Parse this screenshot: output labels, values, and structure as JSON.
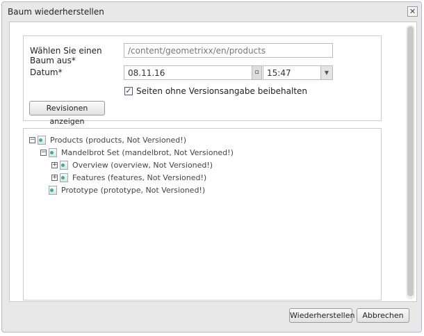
{
  "dialog": {
    "title": "Baum wiederherstellen",
    "close_icon": "close-icon"
  },
  "form": {
    "tree_label": "Wählen Sie einen Baum aus*",
    "tree_path": "/content/geometrixx/en/products",
    "date_label": "Datum*",
    "date": "08.11.16",
    "time": "15:47",
    "keep_checkbox_label": "Seiten ohne Versionsangabe beibehalten",
    "keep_checked": true,
    "show_revisions_button": "Revisionen anzeigen"
  },
  "tree": [
    {
      "label": "Products (products, Not Versioned!)",
      "level": 0,
      "toggle": "−"
    },
    {
      "label": "Mandelbrot Set (mandelbrot, Not Versioned!)",
      "level": 1,
      "toggle": "−"
    },
    {
      "label": "Overview (overview, Not Versioned!)",
      "level": 2,
      "toggle": "+"
    },
    {
      "label": "Features (features, Not Versioned!)",
      "level": 2,
      "toggle": "+"
    },
    {
      "label": "Prototype (prototype, Not Versioned!)",
      "level": 1,
      "toggle": ""
    }
  ],
  "footer": {
    "restore_button": "Wiederherstellen",
    "cancel_button": "Abbrechen"
  }
}
